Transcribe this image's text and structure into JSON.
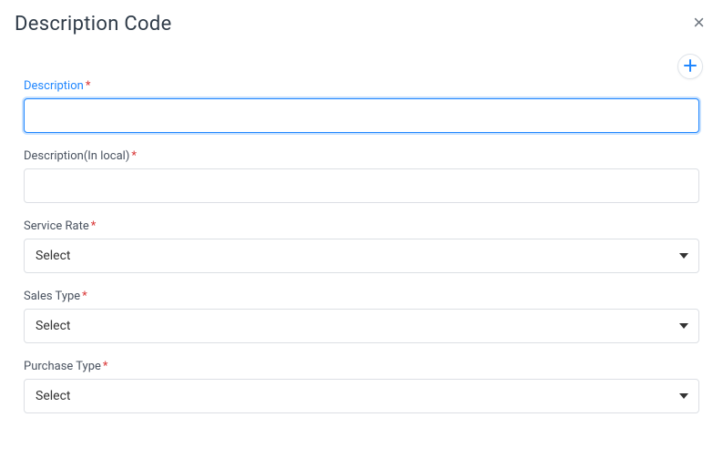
{
  "header": {
    "title": "Description Code"
  },
  "form": {
    "description": {
      "label": "Description",
      "value": ""
    },
    "descriptionLocal": {
      "label": "Description(In local)",
      "value": ""
    },
    "serviceRate": {
      "label": "Service Rate",
      "selected": "Select"
    },
    "salesType": {
      "label": "Sales Type",
      "selected": "Select"
    },
    "purchaseType": {
      "label": "Purchase Type",
      "selected": "Select"
    }
  }
}
